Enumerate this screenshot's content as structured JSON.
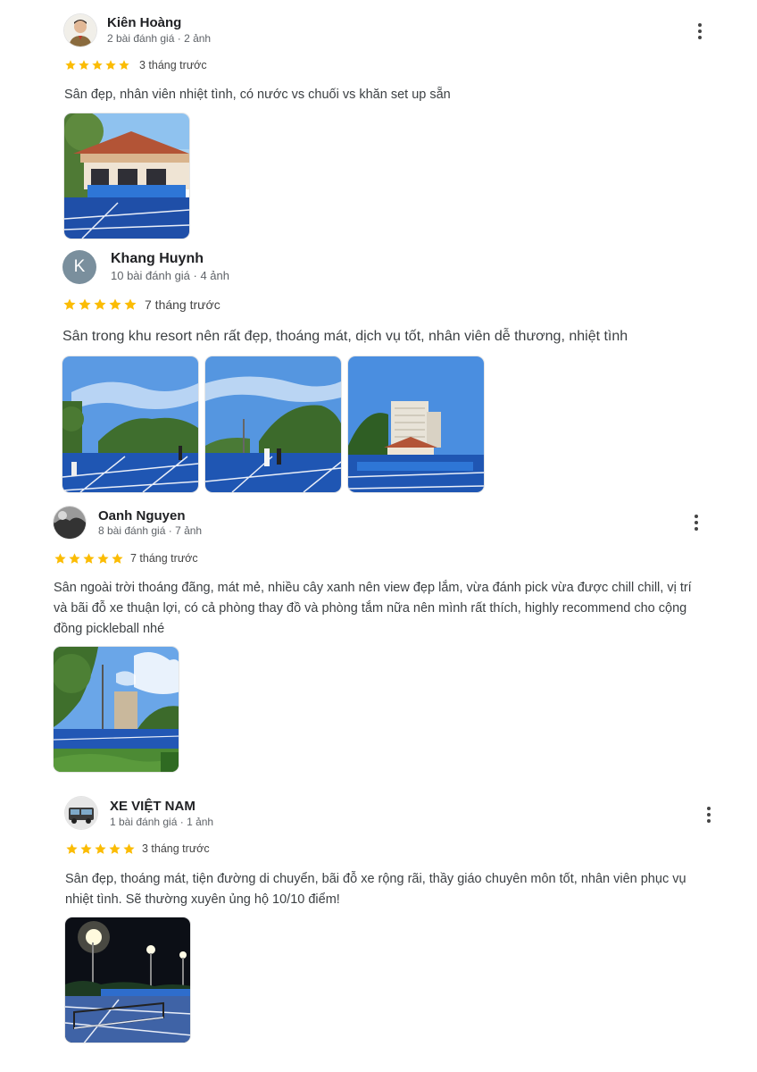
{
  "reviews": [
    {
      "name": "Kiên Hoàng",
      "meta": "2 bài đánh giá · 2 ảnh",
      "rating": 5,
      "time": "3 tháng trước",
      "text": "Sân đẹp, nhân viên nhiệt tình, có nước vs chuối vs khăn set up sẵn",
      "photo_count": 1
    },
    {
      "name": "Khang Huynh",
      "avatar_letter": "K",
      "meta": "10 bài đánh giá · 4 ảnh",
      "rating": 5,
      "time": "7 tháng trước",
      "text": "Sân trong khu resort nên rất đẹp, thoáng mát, dịch vụ tốt, nhân viên dễ thương, nhiệt tình",
      "photo_count": 3
    },
    {
      "name": "Oanh Nguyen",
      "meta": "8 bài đánh giá · 7 ảnh",
      "rating": 5,
      "time": "7 tháng trước",
      "text": "Sân ngoài trời thoáng đãng, mát mẻ, nhiều cây xanh nên view đẹp lắm, vừa đánh pick vừa được chill chill, vị trí và bãi đỗ xe thuận lợi, có cả phòng thay đồ và phòng tắm nữa nên mình rất thích, highly recommend cho cộng đồng pickleball nhé",
      "photo_count": 1
    },
    {
      "name": "XE VIỆT NAM",
      "meta": "1 bài đánh giá · 1 ảnh",
      "rating": 5,
      "time": "3 tháng trước",
      "text": "Sân đẹp, thoáng mát, tiện đường di chuyển, bãi đỗ xe rộng rãi, thầy giáo chuyên môn tốt, nhân viên phục vụ nhiệt tình. Sẽ thường xuyên ủng hộ 10/10 điểm!",
      "photo_count": 1
    }
  ],
  "colors": {
    "star": "#fbbc04",
    "court": "#1f4fa8",
    "sky": "#5b9ae3"
  },
  "icons": {
    "more": "more-vert-icon",
    "star": "star-icon"
  }
}
